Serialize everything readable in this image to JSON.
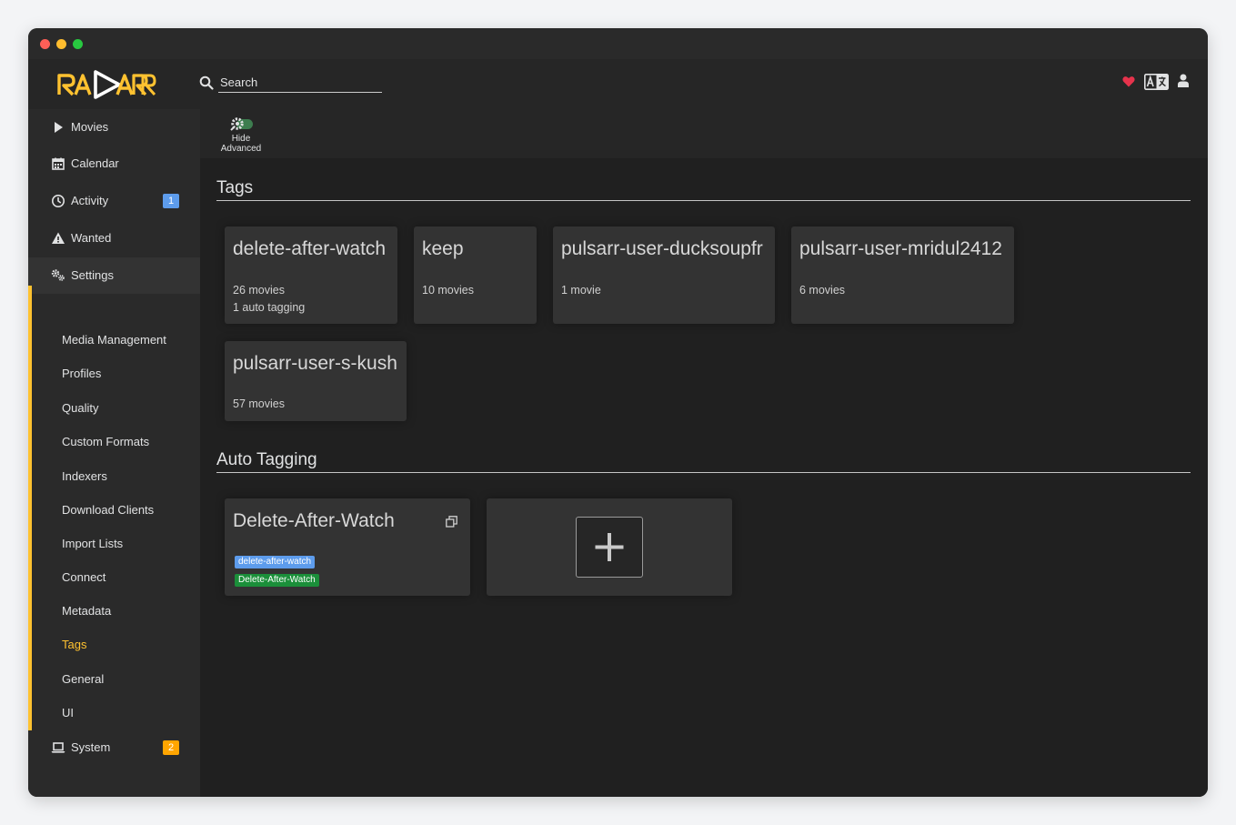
{
  "app": {
    "name": "RADARR",
    "colors": {
      "accent": "#ffc230",
      "badge_info": "#5d9cec",
      "badge_warning": "#ffa500",
      "danger": "#e6334c"
    }
  },
  "header": {
    "search_placeholder": "Search",
    "icons": [
      "heart-icon",
      "translate-icon",
      "user-icon"
    ]
  },
  "sidebar": {
    "items": [
      {
        "label": "Movies",
        "icon": "play-icon"
      },
      {
        "label": "Calendar",
        "icon": "calendar-icon"
      },
      {
        "label": "Activity",
        "icon": "clock-icon",
        "badge": "1"
      },
      {
        "label": "Wanted",
        "icon": "warning-icon"
      },
      {
        "label": "Settings",
        "icon": "cogs-icon"
      },
      {
        "label": "System",
        "icon": "laptop-icon",
        "badge": "2"
      }
    ],
    "settings_sub": [
      "Media Management",
      "Profiles",
      "Quality",
      "Custom Formats",
      "Indexers",
      "Download Clients",
      "Import Lists",
      "Connect",
      "Metadata",
      "Tags",
      "General",
      "UI"
    ],
    "active_sub": "Tags"
  },
  "toolbar": {
    "advanced_line1": "Hide",
    "advanced_line2": "Advanced"
  },
  "tags_section": {
    "title": "Tags",
    "tags": [
      {
        "name": "delete-after-watch",
        "line1": "26 movies",
        "line2": "1 auto tagging"
      },
      {
        "name": "keep",
        "line1": "10 movies"
      },
      {
        "name": "pulsarr-user-ducksoupfr",
        "line1": "1 movie"
      },
      {
        "name": "pulsarr-user-mridul2412",
        "line1": "6 movies"
      },
      {
        "name": "pulsarr-user-s-kush",
        "line1": "57 movies"
      }
    ]
  },
  "auto_tagging": {
    "title": "Auto Tagging",
    "items": [
      {
        "name": "Delete-After-Watch",
        "tag_label": "delete-after-watch",
        "spec_label": "Delete-After-Watch"
      }
    ]
  }
}
